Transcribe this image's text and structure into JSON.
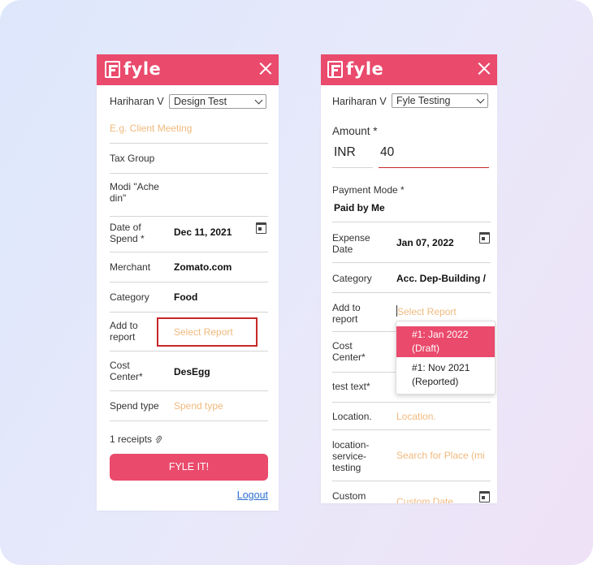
{
  "left_panel": {
    "logo_text": "fyle",
    "user_name": "Hariharan V",
    "org_select": "Design Test",
    "purpose_placeholder": "E.g. Client Meeting",
    "fields": {
      "tax_group_label": "Tax Group",
      "modi_label": "Modi \"Ache din\"",
      "date_label": "Date of Spend *",
      "date_value": "Dec 11, 2021",
      "merchant_label": "Merchant",
      "merchant_value": "Zomato.com",
      "category_label": "Category",
      "category_value": "Food",
      "report_label": "Add to report",
      "report_placeholder": "Select Report",
      "cost_center_label": "Cost Center*",
      "cost_center_value": "DesEgg",
      "spend_type_label": "Spend type",
      "spend_type_placeholder": "Spend type"
    },
    "receipts": "1 receipts",
    "submit_label": "FYLE IT!",
    "logout_label": "Logout"
  },
  "right_panel": {
    "logo_text": "fyle",
    "user_name": "Hariharan V",
    "org_select": "Fyle Testing",
    "amount_label": "Amount *",
    "currency": "INR",
    "amount_value": "40",
    "payment_mode_label": "Payment Mode *",
    "payment_mode_value": "Paid by Me",
    "expense_date_label": "Expense Date",
    "expense_date_value": "Jan 07, 2022",
    "category_label": "Category",
    "category_value": "Acc. Dep-Building /",
    "report_label": "Add to report",
    "report_placeholder": "Select Report",
    "cost_center_label": "Cost Center*",
    "test_text_label": "test text*",
    "location_label": "Location.",
    "location_placeholder": "Location.",
    "location_service_label": "location-service-testing",
    "location_service_placeholder": "Search for Place (min",
    "custom_label": "Custom",
    "custom_placeholder": "Custom Date",
    "dropdown": {
      "selected_line1": "#1:  Jan 2022",
      "selected_line2": "(Draft)",
      "other_line1": "#1:  Nov 2021",
      "other_line2": "(Reported)"
    }
  },
  "colors": {
    "brand": "#ea4a6c",
    "placeholder": "#f0b97d",
    "highlight_border": "#c62828",
    "link": "#2a6fd1"
  }
}
